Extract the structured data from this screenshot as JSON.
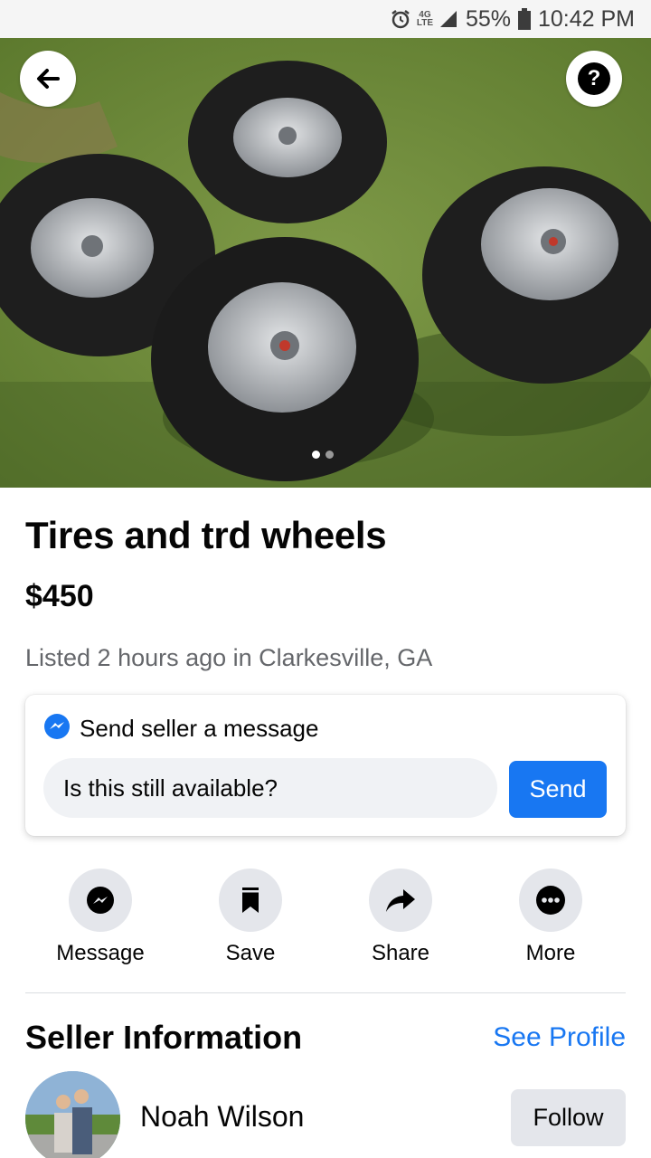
{
  "status_bar": {
    "battery": "55%",
    "time": "10:42 PM",
    "network": "4G LTE",
    "icons": [
      "alarm-icon",
      "network-icon",
      "signal-icon",
      "battery-icon"
    ]
  },
  "hero": {
    "image_count": 2,
    "current_image": 1,
    "icons": [
      "back-arrow-icon",
      "help-icon"
    ]
  },
  "listing": {
    "title": "Tires and trd wheels",
    "price": "$450",
    "listed": "Listed 2 hours ago in Clarkesville, GA"
  },
  "message_card": {
    "header": "Send seller a message",
    "input_value": "Is this still available?",
    "send_label": "Send",
    "icon": "messenger-icon"
  },
  "actions": [
    {
      "label": "Message",
      "icon": "messenger-icon"
    },
    {
      "label": "Save",
      "icon": "bookmark-icon"
    },
    {
      "label": "Share",
      "icon": "share-icon"
    },
    {
      "label": "More",
      "icon": "more-icon"
    }
  ],
  "seller": {
    "heading": "Seller Information",
    "see_profile": "See Profile",
    "name": "Noah Wilson",
    "follow_label": "Follow"
  },
  "colors": {
    "accent": "#1877f2",
    "secondary_text": "#65676b",
    "button_gray": "#e4e6eb",
    "input_bg": "#f0f2f5"
  }
}
